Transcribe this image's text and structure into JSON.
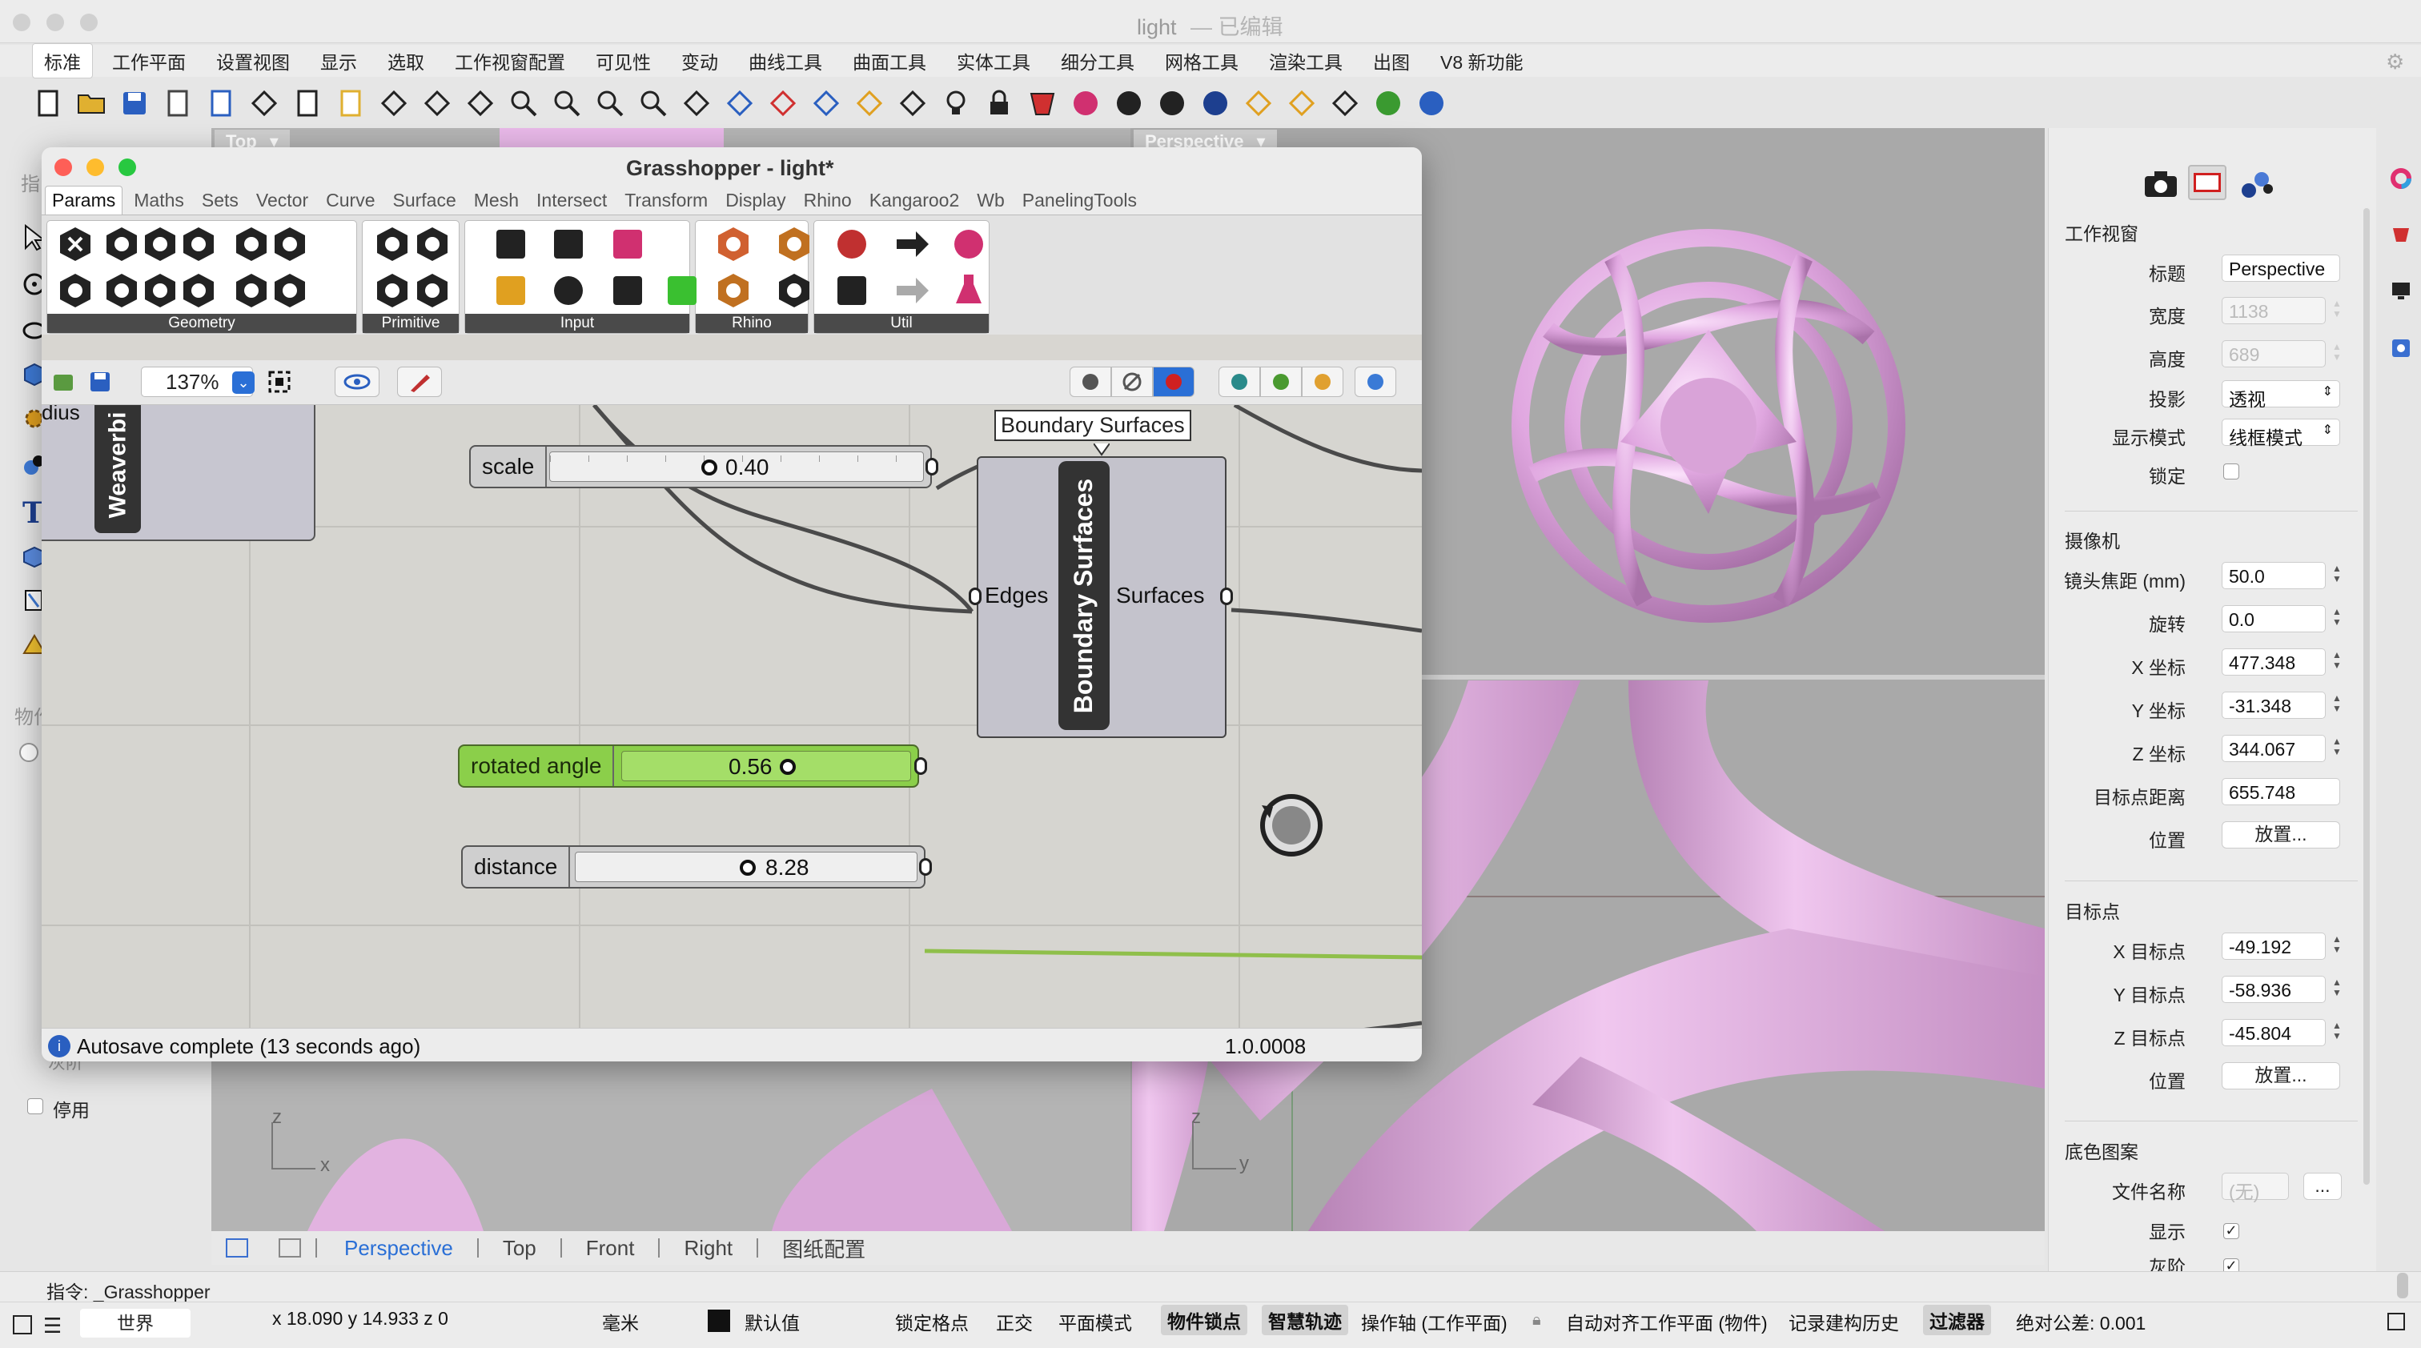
{
  "window": {
    "title": "light",
    "edited": "— 已编辑"
  },
  "menu": {
    "items": [
      "标准",
      "工作平面",
      "设置视图",
      "显示",
      "选取",
      "工作视窗配置",
      "可见性",
      "变动",
      "曲线工具",
      "曲面工具",
      "实体工具",
      "细分工具",
      "网格工具",
      "渲染工具",
      "出图",
      "V8 新功能"
    ],
    "active": "标准"
  },
  "toolbar": {
    "icons": [
      "new-file-icon",
      "open-folder-icon",
      "save-icon",
      "print-icon",
      "import-icon",
      "cut-icon",
      "copy-icon",
      "paste-icon",
      "undo-icon",
      "pan-hand-icon",
      "rotate-view-icon",
      "zoom-icon",
      "zoom-window-icon",
      "zoom-extents-icon",
      "zoom-selected-icon",
      "rotate-camera-icon",
      "four-viewports-icon",
      "car-render-icon",
      "plane-grid-icon",
      "object-snap-icon",
      "layout-icon",
      "light-bulb-icon",
      "lock-icon",
      "grasshopper-icon",
      "color-wheel-icon",
      "sphere-wire-icon",
      "sphere-grid-icon",
      "sphere-render-icon",
      "pen-icon",
      "gear-group-icon",
      "dimension-icon",
      "green-sphere-icon",
      "help-icon"
    ]
  },
  "viewports": {
    "top_tab": "Top",
    "perspective_tab": "Perspective",
    "axis_x": "x",
    "axis_y": "y",
    "axis_z": "z"
  },
  "left_panel": {
    "cut_text_1": "指",
    "cut_text_2": "物作",
    "cut_text_3": "灰阶",
    "disable_label": "停用"
  },
  "grasshopper": {
    "title": "Grasshopper - light*",
    "tabs": [
      "Params",
      "Maths",
      "Sets",
      "Vector",
      "Curve",
      "Surface",
      "Mesh",
      "Intersect",
      "Transform",
      "Display",
      "Rhino",
      "Kangaroo2",
      "Wb",
      "PanelingTools"
    ],
    "active_tab": "Params",
    "groups": [
      "Geometry",
      "Primitive",
      "Input",
      "Rhino",
      "Util"
    ],
    "zoom": "137%",
    "canvas": {
      "weaverbird_label": "Weaverbi",
      "radius_partial": "dius",
      "tooltip": "Boundary Surfaces",
      "component_name": "Boundary Surfaces",
      "input_port": "Edges",
      "output_port": "Surfaces",
      "sliders": [
        {
          "name": "scale",
          "value": "0.40",
          "position": 0.4
        },
        {
          "name": "rotated angle",
          "value": "0.56",
          "position": 0.56
        },
        {
          "name": "distance",
          "value": "8.28",
          "position": 0.43
        }
      ]
    },
    "status": "Autosave complete (13 seconds ago)",
    "version": "1.0.0008"
  },
  "viewport_tabs": {
    "items": [
      "Perspective",
      "Top",
      "Front",
      "Right",
      "图纸配置"
    ],
    "active": "Perspective"
  },
  "properties": {
    "section_viewport": "工作视窗",
    "title_label": "标题",
    "title_value": "Perspective",
    "width_label": "宽度",
    "width_value": "1138",
    "height_label": "高度",
    "height_value": "689",
    "projection_label": "投影",
    "projection_value": "透视",
    "display_label": "显示模式",
    "display_value": "线框模式",
    "lock_label": "锁定",
    "section_camera": "摄像机",
    "focal_label": "镜头焦距 (mm)",
    "focal_value": "50.0",
    "rotation_label": "旋转",
    "rotation_value": "0.0",
    "x_label": "X 坐标",
    "x_value": "477.348",
    "y_label": "Y 坐标",
    "y_value": "-31.348",
    "z_label": "Z 坐标",
    "z_value": "344.067",
    "dist_label": "目标点距离",
    "dist_value": "655.748",
    "pos_label": "位置",
    "place_btn": "放置...",
    "section_target": "目标点",
    "tx_label": "X 目标点",
    "tx_value": "-49.192",
    "ty_label": "Y 目标点",
    "ty_value": "-58.936",
    "tz_label": "Z 目标点",
    "tz_value": "-45.804",
    "tpos_label": "位置",
    "tplace_btn": "放置...",
    "section_bg": "底色图案",
    "file_label": "文件名称",
    "file_value": "(无)",
    "file_btn": "...",
    "show_label": "显示",
    "gray_label": "灰阶"
  },
  "command": {
    "text": "指令: _Grasshopper"
  },
  "statusbar": {
    "world": "世界",
    "coords": "x 18.090  y 14.933  z 0",
    "unit": "毫米",
    "layer": "默认值",
    "items": [
      "锁定格点",
      "正交",
      "平面模式",
      "物件锁点",
      "智慧轨迹",
      "操作轴 (工作平面)",
      "自动对齐工作平面 (物件)",
      "记录建构历史",
      "过滤器"
    ],
    "highlighted": [
      "物件锁点",
      "智慧轨迹",
      "过滤器"
    ],
    "tolerance": "绝对公差: 0.001"
  },
  "colors": {
    "accent": "#2a6fd6",
    "pink": "#e8b8e8",
    "slider_green": "#8bcf4a"
  }
}
